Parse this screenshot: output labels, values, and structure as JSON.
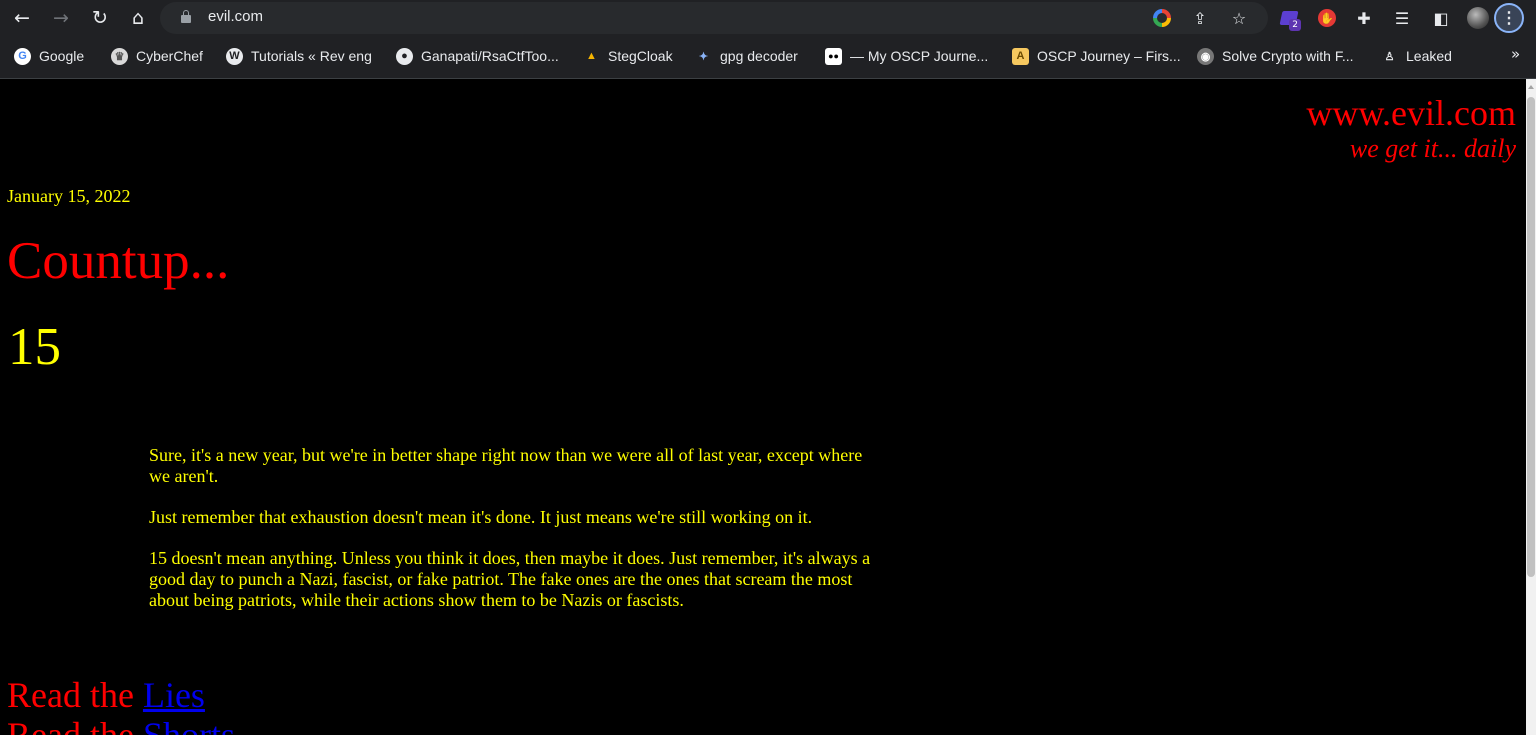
{
  "browser": {
    "url": "evil.com",
    "extension_badge": "2",
    "icons": {
      "back": "arrow-left-icon",
      "forward": "arrow-right-icon",
      "reload": "reload-icon",
      "home": "home-icon",
      "lock": "lock-icon",
      "share": "share-icon",
      "star": "star-icon",
      "extensions": "puzzle-icon",
      "reading_list": "reading-list-icon",
      "side_panel": "side-panel-icon",
      "menu": "kebab-menu-icon"
    }
  },
  "bookmarks": [
    {
      "label": "Google"
    },
    {
      "label": "CyberChef"
    },
    {
      "label": "Tutorials « Rev eng"
    },
    {
      "label": "Ganapati/RsaCtfToo..."
    },
    {
      "label": "StegCloak"
    },
    {
      "label": "gpg decoder"
    },
    {
      "label": "— My OSCP Journe..."
    },
    {
      "label": "OSCP Journey – Firs..."
    },
    {
      "label": "Solve Crypto with F..."
    },
    {
      "label": "Leaked"
    }
  ],
  "bookmarks_more": "»",
  "site": {
    "name": "www.evil.com",
    "tagline": "we get it... daily"
  },
  "post": {
    "date": "January 15, 2022",
    "title": "Countup...",
    "number": "15",
    "paragraphs": [
      "Sure, it's a new year, but we're in better shape right now than we were all of last year, except where we aren't.",
      "Just remember that exhaustion doesn't mean it's done. It just means we're still working on it.",
      "15 doesn't mean anything. Unless you think it does, then maybe it does. Just remember, it's always a good day to punch a Nazi, fascist, or fake patriot. The fake ones are the ones that scream the most about being patriots, while their actions show them to be Nazis or fascists."
    ]
  },
  "read_links": [
    {
      "prefix": "Read the ",
      "link": "Lies"
    },
    {
      "prefix": "Read the ",
      "link": "Shorts"
    }
  ],
  "colors": {
    "page_bg": "#000000",
    "accent_red": "#ff0000",
    "text_yellow": "#ffff00",
    "link_blue": "#0000ee",
    "chrome_bg": "#202124"
  }
}
